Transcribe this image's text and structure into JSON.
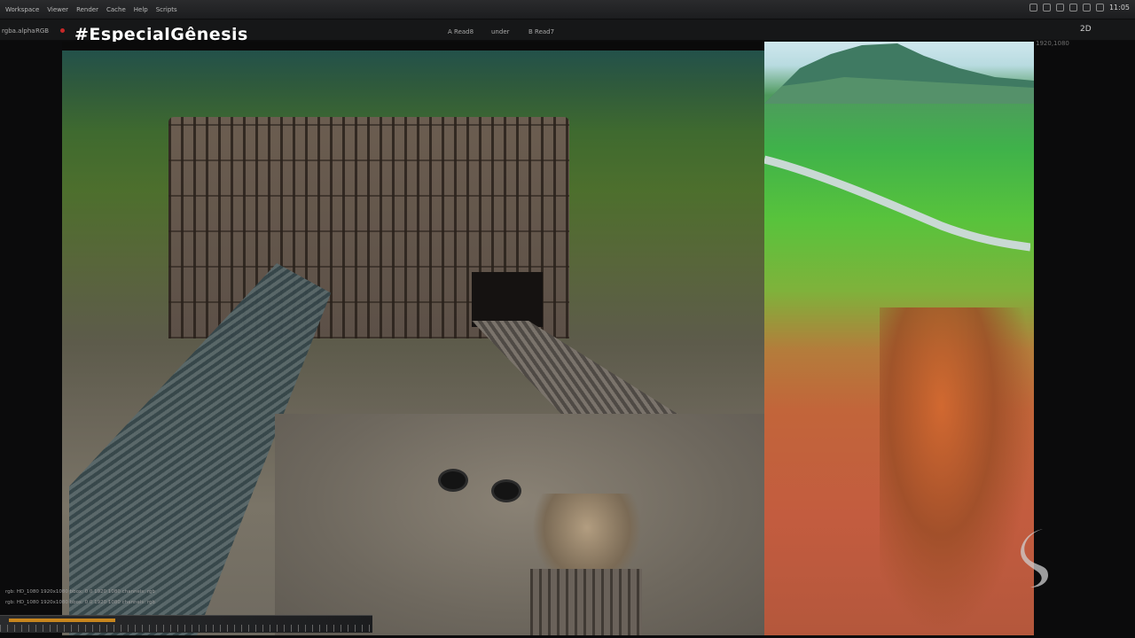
{
  "menu": {
    "items": [
      "Workspace",
      "Viewer",
      "Render",
      "Cache",
      "Help",
      "Scripts"
    ]
  },
  "tray": {
    "clock": "11:05"
  },
  "toolbar": {
    "layer": "rgba.alpha",
    "channel": "RGB",
    "input_a": "A  Read8",
    "operation": "under",
    "input_b": "B  Read7",
    "mode": "2D"
  },
  "overlay": {
    "hashtag": "#EspecialGênesis"
  },
  "viewer": {
    "resolution_label": "1920,1080"
  },
  "info": {
    "row1": "rgb:  HD_1080  1920x1080   bbox: 0 0 1920 1080  channels: rgb",
    "row2": "rgb:  HD_1080  1920x1080   bbox: 0 0 1920 1080  channels: rgb"
  },
  "colors": {
    "timeline_accent": "#c8861e",
    "broadcaster_logo": "#cfcfcf"
  }
}
